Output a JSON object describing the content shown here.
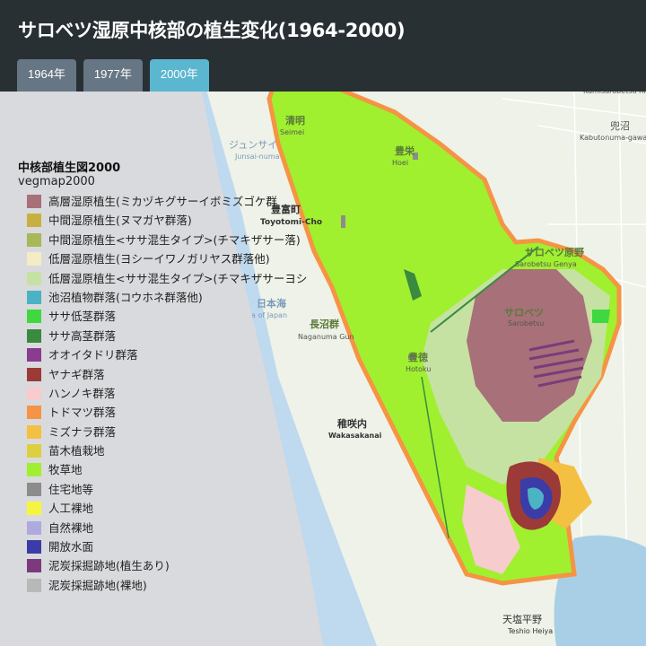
{
  "header": {
    "title": "サロベツ湿原中核部の植生変化(1964-2000)",
    "tabs": [
      {
        "label": "1964年",
        "active": false
      },
      {
        "label": "1977年",
        "active": false
      },
      {
        "label": "2000年",
        "active": true
      }
    ]
  },
  "legend": {
    "title": "中核部植生図2000",
    "subtitle": "vegmap2000",
    "items": [
      {
        "label": "高層湿原植生(ミカヅキグサーイボミズゴケ群",
        "color": "#a87078"
      },
      {
        "label": "中間湿原植生(ヌマガヤ群落)",
        "color": "#c8b040"
      },
      {
        "label": "中間湿原植生<ササ混生タイプ>(チマキザサー落)",
        "color": "#a8b858"
      },
      {
        "label": "低層湿原植生(ヨシーイワノガリヤス群落他)",
        "color": "#f3ecc5"
      },
      {
        "label": "低層湿原植生<ササ混生タイプ>(チマキザサーヨシ",
        "color": "#c6e2a2"
      },
      {
        "label": "池沼植物群落(コウホネ群落他)",
        "color": "#4bb4c4"
      },
      {
        "label": "ササ低茎群落",
        "color": "#40d840"
      },
      {
        "label": "ササ高茎群落",
        "color": "#3a8a40"
      },
      {
        "label": "オオイタドリ群落",
        "color": "#8a3c90"
      },
      {
        "label": "ヤナギ群落",
        "color": "#9c3a38"
      },
      {
        "label": "ハンノキ群落",
        "color": "#f6cccc"
      },
      {
        "label": "トドマツ群落",
        "color": "#f59444"
      },
      {
        "label": "ミズナラ群落",
        "color": "#f3c042"
      },
      {
        "label": "苗木植栽地",
        "color": "#dcd040"
      },
      {
        "label": "牧草地",
        "color": "#a0f030"
      },
      {
        "label": "住宅地等",
        "color": "#8c8c8c"
      },
      {
        "label": "人工裸地",
        "color": "#f5f540"
      },
      {
        "label": "自然裸地",
        "color": "#aeaae0"
      },
      {
        "label": "開放水面",
        "color": "#3c3ca8"
      },
      {
        "label": "泥炭採掘跡地(植生あり)",
        "color": "#7c3a7c"
      },
      {
        "label": "泥炭採掘跡地(裸地)",
        "color": "#b8b8b8"
      }
    ]
  },
  "map": {
    "places": [
      {
        "jp": "清明",
        "en": "Seimei"
      },
      {
        "jp": "豊栄",
        "en": "Hoei"
      },
      {
        "jp": "豊富町",
        "en": "Toyotomi-Cho"
      },
      {
        "jp": "日本海",
        "en": "Sea of Japan"
      },
      {
        "jp": "長沼群",
        "en": "Naganuma Gun"
      },
      {
        "jp": "ジュンサイ",
        "en": "Junsai-numa"
      },
      {
        "jp": "サロベツ原野",
        "en": "Sarobetsu Genya"
      },
      {
        "jp": "サロベツ",
        "en": "Sarobetsu"
      },
      {
        "jp": "豊徳",
        "en": "Hotoku"
      },
      {
        "jp": "稚咲内",
        "en": "Wakasakanai"
      },
      {
        "jp": "兜沼",
        "en": "Kabutonuma-gawa"
      },
      {
        "jp": "天塩平野",
        "en": "Teshio Heiya"
      },
      {
        "jp": "",
        "en": "Kamisarobetsu Rive"
      }
    ]
  }
}
